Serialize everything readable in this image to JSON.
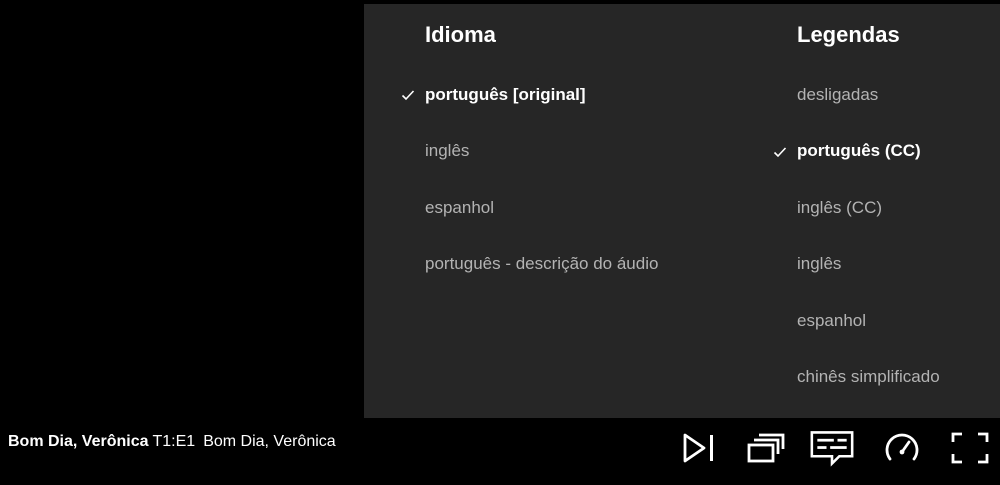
{
  "audio_panel": {
    "language_heading": "Idioma",
    "languages": [
      {
        "label": "português [original]",
        "selected": true
      },
      {
        "label": "inglês",
        "selected": false
      },
      {
        "label": "espanhol",
        "selected": false
      },
      {
        "label": "português - descrição do áudio",
        "selected": false
      }
    ],
    "subtitles_heading": "Legendas",
    "subtitles": [
      {
        "label": "desligadas",
        "selected": false
      },
      {
        "label": "português (CC)",
        "selected": true
      },
      {
        "label": "inglês (CC)",
        "selected": false
      },
      {
        "label": "inglês",
        "selected": false
      },
      {
        "label": "espanhol",
        "selected": false
      },
      {
        "label": "chinês simplificado",
        "selected": false
      }
    ]
  },
  "player": {
    "show_title": "Bom Dia, Verônica",
    "episode_code": "T1:E1",
    "episode_title": "Bom Dia, Verônica",
    "controls": [
      {
        "name": "next-episode-icon"
      },
      {
        "name": "episodes-icon"
      },
      {
        "name": "audio-subtitles-icon"
      },
      {
        "name": "playback-speed-icon"
      },
      {
        "name": "fullscreen-icon"
      }
    ]
  },
  "colors": {
    "panel_background": "#262626",
    "selected_text": "#ffffff",
    "unselected_text": "#b3b3b3",
    "page_background": "#000000"
  }
}
